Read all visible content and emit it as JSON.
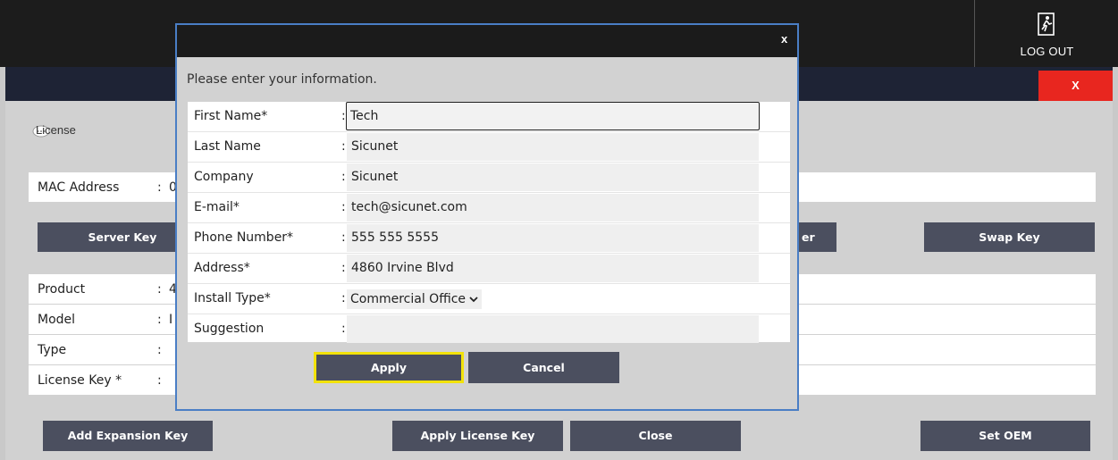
{
  "header": {
    "logout_label": "LOG OUT"
  },
  "panel": {
    "close_label": "X",
    "title": "License",
    "mac_row": {
      "label": "MAC Address",
      "colon": ":",
      "value_partial": "0"
    },
    "buttons_row1": {
      "server_key": "Server Key",
      "partial": "er",
      "swap_key": "Swap Key"
    },
    "info_rows": [
      {
        "label": "Product",
        "colon": ":",
        "value_partial": "4"
      },
      {
        "label": "Model",
        "colon": ":",
        "value_partial": "I"
      },
      {
        "label": "Type",
        "colon": ":",
        "value_partial": ""
      },
      {
        "label": "License Key *",
        "colon": ":",
        "value_partial": ""
      }
    ],
    "buttons_row2": {
      "add_expansion": "Add Expansion Key",
      "apply_license": "Apply License Key",
      "close": "Close",
      "set_oem": "Set OEM"
    }
  },
  "modal": {
    "close_label": "x",
    "prompt": "Please enter your information.",
    "fields": [
      {
        "label": "First Name*",
        "colon": ":",
        "value": "Tech"
      },
      {
        "label": "Last Name",
        "colon": ":",
        "value": "Sicunet"
      },
      {
        "label": "Company",
        "colon": ":",
        "value": "Sicunet"
      },
      {
        "label": "E-mail*",
        "colon": ":",
        "value": "tech@sicunet.com"
      },
      {
        "label": "Phone Number*",
        "colon": ":",
        "value": "555 555 5555"
      },
      {
        "label": "Address*",
        "colon": ":",
        "value": "4860 Irvine Blvd"
      },
      {
        "label": "Install Type*",
        "colon": ":",
        "value": "Commercial Office"
      },
      {
        "label": "Suggestion",
        "colon": ":",
        "value": ""
      }
    ],
    "apply_label": "Apply",
    "cancel_label": "Cancel"
  },
  "colors": {
    "topbar": "#1c1c1c",
    "panel_header": "#1e2335",
    "close_red": "#e8261f",
    "button": "#4b4f5f",
    "focus_yellow": "#f2e20a",
    "modal_border": "#4a7ec5"
  }
}
